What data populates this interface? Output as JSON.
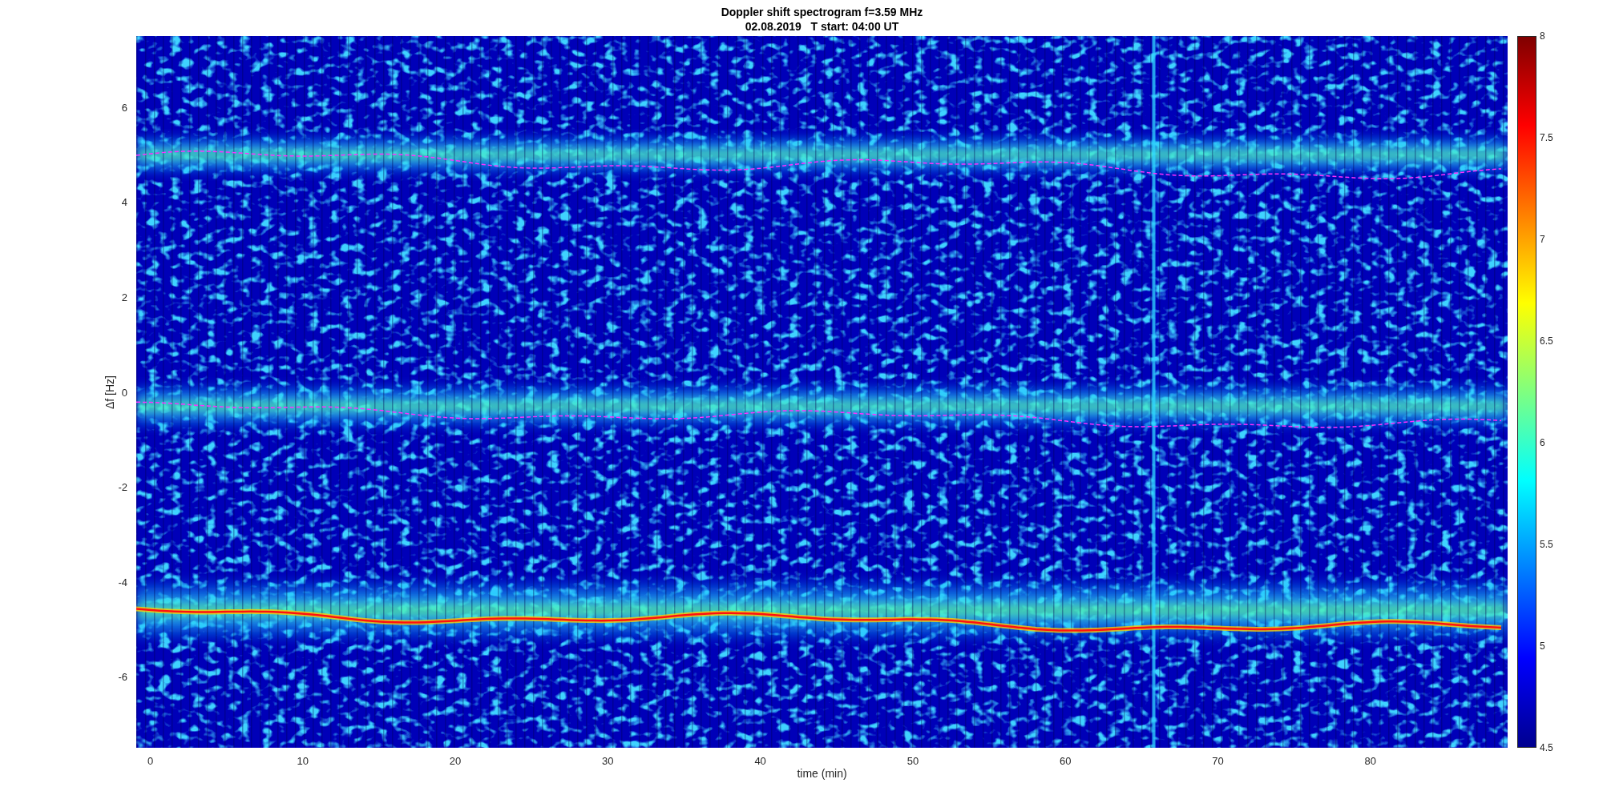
{
  "figure": {
    "title_lines": [
      "Doppler shift spectrogram f=3.59 MHz",
      "02.08.2019   T start: 04:00 UT"
    ]
  },
  "axes": {
    "xlabel": "time (min)",
    "ylabel": "Δf [Hz]",
    "xticks": [
      "0",
      "10",
      "20",
      "30",
      "40",
      "50",
      "60",
      "70",
      "80"
    ],
    "yticks": [
      "6",
      "4",
      "2",
      "0",
      "-2",
      "-4",
      "-6"
    ]
  },
  "colorbar": {
    "ticks": [
      "8",
      "7.5",
      "7",
      "6.5",
      "6",
      "5.5",
      "5",
      "4.5"
    ]
  }
}
